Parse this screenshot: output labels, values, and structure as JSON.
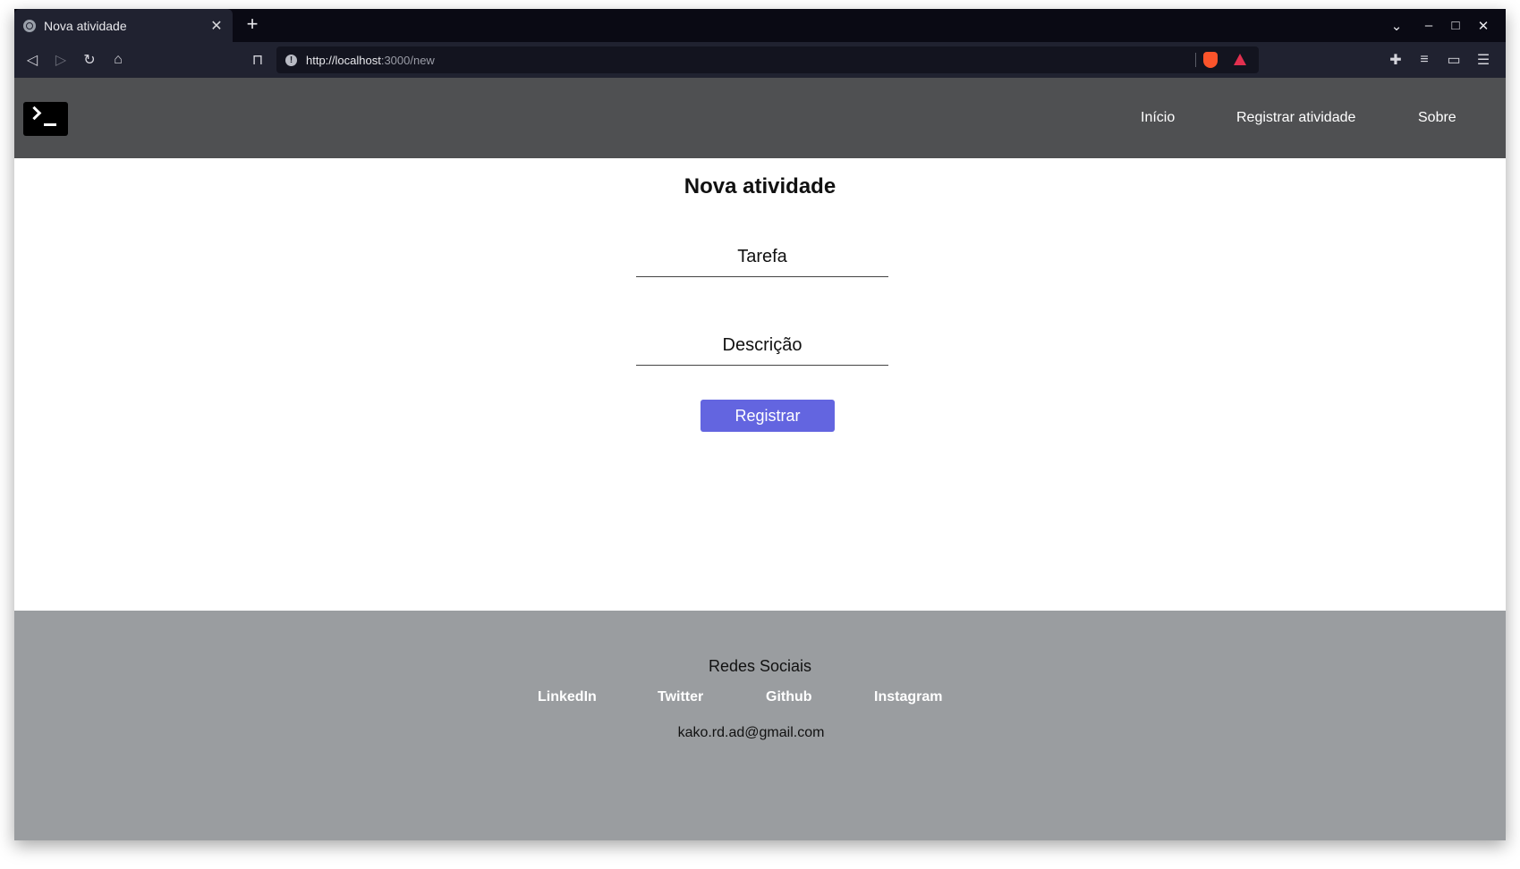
{
  "browser": {
    "tab_title": "Nova atividade",
    "tab_close": "✕",
    "new_tab": "+",
    "url_host": "http://localhost",
    "url_rest": ":3000/new",
    "icons": [
      "back-icon",
      "forward-icon",
      "reload-icon",
      "home-icon",
      "bookmark-icon",
      "info-icon",
      "brave-shield-icon",
      "brave-rewards-icon",
      "extensions-icon",
      "playlist-icon",
      "wallet-icon",
      "menu-icon"
    ]
  },
  "site_nav": {
    "items": [
      {
        "label": "Início"
      },
      {
        "label": "Registrar atividade"
      },
      {
        "label": "Sobre"
      }
    ]
  },
  "form": {
    "title": "Nova atividade",
    "task_placeholder": "Tarefa",
    "description_placeholder": "Descrição",
    "submit_label": "Registrar"
  },
  "footer": {
    "title": "Redes Sociais",
    "links": [
      {
        "label": "LinkedIn"
      },
      {
        "label": "Twitter"
      },
      {
        "label": "Github"
      },
      {
        "label": "Instagram"
      }
    ],
    "email": "kako.rd.ad@gmail.com"
  },
  "colors": {
    "header_bg": "#4f5052",
    "footer_bg": "#9a9da0",
    "button_bg": "#6365e0",
    "browser_chrome": "#202230"
  }
}
